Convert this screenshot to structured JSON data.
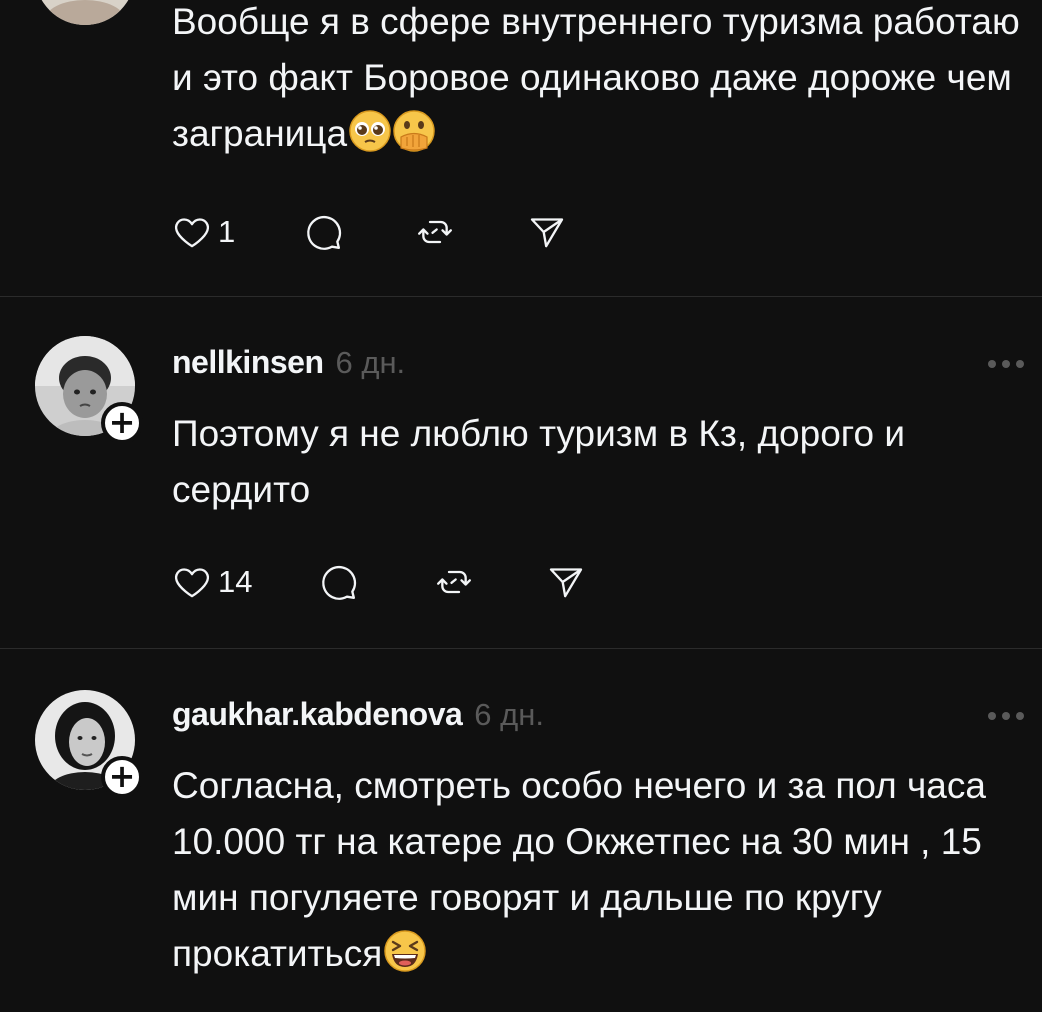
{
  "colors": {
    "background": "#101010",
    "text_primary": "#f3f5f7",
    "text_secondary": "#5a5a5a",
    "divider": "#2b2b2b"
  },
  "posts": [
    {
      "text": "Вообще я в сфере внутреннего туризма работаю и это факт Боровое одинаково даже дороже чем заграница",
      "emojis": [
        "pleading-face-emoji",
        "face-with-hand-over-mouth-emoji"
      ],
      "likes": "1"
    },
    {
      "username": "nellkinsen",
      "time": "6 дн.",
      "text": "Поэтому я не люблю туризм в  Кз, дорого и сердито",
      "likes": "14"
    },
    {
      "username": "gaukhar.kabdenova",
      "time": "6 дн.",
      "text": "Согласна, смотреть особо нечего и за пол часа 10.000 тг на катере до Окжетпес на 30 мин , 15 мин погуляете говорят и дальше по кругу прокатиться",
      "emojis": [
        "grinning-squinting-face-emoji"
      ]
    }
  ]
}
